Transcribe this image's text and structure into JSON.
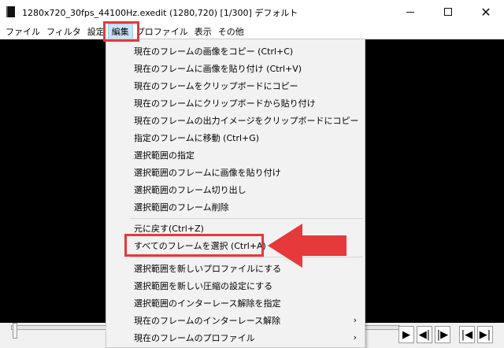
{
  "window": {
    "title": "1280x720_30fps_44100Hz.exedit (1280,720)  [1/300]  デフォルト",
    "minimize": "",
    "maximize": "",
    "close": "✕"
  },
  "menubar": [
    "ファイル",
    "フィルタ",
    "設定",
    "編集",
    "プロファイル",
    "表示",
    "その他"
  ],
  "edit_menu": {
    "items": [
      "現在のフレームの画像をコピー (Ctrl+C)",
      "現在のフレームに画像を貼り付け (Ctrl+V)",
      "現在のフレームをクリップボードにコピー",
      "現在のフレームにクリップボードから貼り付け",
      "現在のフレームの出力イメージをクリップボードにコピー",
      "指定のフレームに移動 (Ctrl+G)",
      "選択範囲の指定",
      "選択範囲のフレームに画像を貼り付け",
      "選択範囲のフレーム切り出し",
      "選択範囲のフレーム削除",
      "元に戻す(Ctrl+Z)",
      "すべてのフレームを選択 (Ctrl+A)",
      "選択範囲を新しいプロファイルにする",
      "選択範囲を新しい圧縮の設定にする",
      "選択範囲のインターレース解除を指定",
      "現在のフレームのインターレース解除",
      "現在のフレームのプロファイル"
    ],
    "submenu_arrow": "›"
  },
  "navigation": {
    "play": "▶",
    "prev_frame": "◀|",
    "next_frame": "|▶",
    "first_frame": "|◀",
    "last_frame": "▶|"
  },
  "colors": {
    "highlight": "#e5393b",
    "menu_selected": "#cce4f7",
    "canvas": "#000000",
    "menu_bg": "#f2f2f2"
  }
}
